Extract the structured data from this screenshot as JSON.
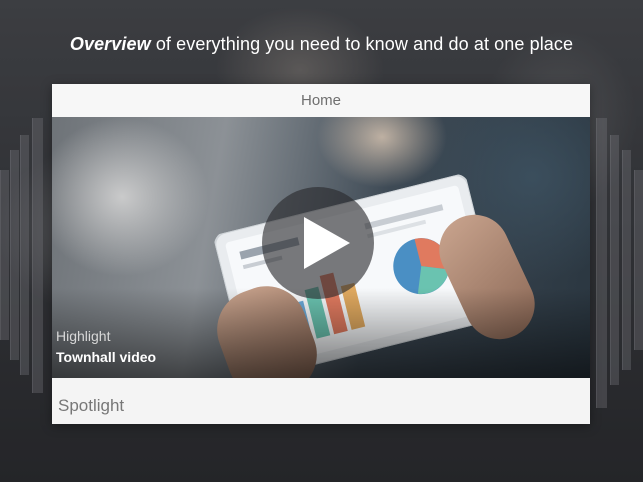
{
  "headline": {
    "emphasis": "Overview",
    "rest": " of everything you need to know and do at one place"
  },
  "card": {
    "header_title": "Home",
    "video": {
      "eyebrow": "Highlight",
      "title": "Townhall video",
      "play_icon": "play-icon"
    },
    "section_title": "Spotlight"
  },
  "colors": {
    "card_background": "#f4f4f4",
    "header_text": "#6f6f6f",
    "headline_text": "#ffffff",
    "play_button_overlay": "#28282c"
  }
}
